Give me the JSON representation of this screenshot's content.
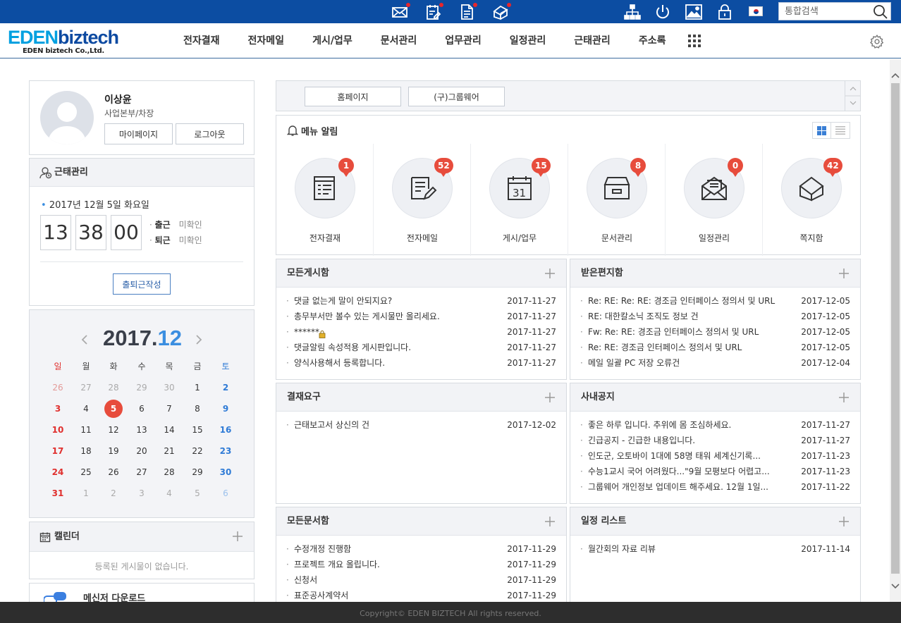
{
  "topbar": {
    "search_placeholder": "통합검색",
    "icons": [
      "mail-icon",
      "approval-icon",
      "document-icon",
      "memo-icon",
      "org-chart-icon",
      "power-icon",
      "image-icon",
      "lock-icon",
      "flag-korea-icon",
      "search-icon"
    ]
  },
  "header": {
    "logo_main_a": "EDEN",
    "logo_main_b": "biztech",
    "logo_sub": "EDEN biztech Co.,Ltd.",
    "nav": [
      "전자결재",
      "전자메일",
      "게시/업무",
      "문서관리",
      "업무관리",
      "일정관리",
      "근태관리",
      "주소록"
    ]
  },
  "profile": {
    "name": "이상윤",
    "dept": "사업본부/차장",
    "mypage_label": "마이페이지",
    "logout_label": "로그아웃"
  },
  "attendance": {
    "title": "근태관리",
    "date": "2017년 12월 5일 화요일",
    "hour": "13",
    "minute": "38",
    "second": "00",
    "in_label": "출근",
    "in_status": "미확인",
    "out_label": "퇴근",
    "out_status": "미확인",
    "write_label": "출퇴근작성"
  },
  "calendar": {
    "year": "2017.",
    "month": "12",
    "weekdays": [
      "일",
      "월",
      "화",
      "수",
      "목",
      "금",
      "토"
    ],
    "days": [
      [
        "26",
        "27",
        "28",
        "29",
        "30",
        "1",
        "2"
      ],
      [
        "3",
        "4",
        "5",
        "6",
        "7",
        "8",
        "9"
      ],
      [
        "10",
        "11",
        "12",
        "13",
        "14",
        "15",
        "16"
      ],
      [
        "17",
        "18",
        "19",
        "20",
        "21",
        "22",
        "23"
      ],
      [
        "24",
        "25",
        "26",
        "27",
        "28",
        "29",
        "30"
      ],
      [
        "31",
        "1",
        "2",
        "3",
        "4",
        "5",
        "6"
      ]
    ],
    "today": "5"
  },
  "schedule_widget": {
    "title": "캘린더",
    "empty": "등록된 게시물이 없습니다."
  },
  "messenger": {
    "title": "메신저 다운로드"
  },
  "quicklinks": [
    "홈페이지",
    "(구)그룹웨어"
  ],
  "menu_alert": {
    "title": "메뉴 알림",
    "items": [
      {
        "label": "전자결재",
        "count": "1",
        "icon": "approval-doc-icon"
      },
      {
        "label": "전자메일",
        "count": "52",
        "icon": "mail-edit-icon"
      },
      {
        "label": "게시/업무",
        "count": "15",
        "icon": "calendar-31-icon"
      },
      {
        "label": "문서관리",
        "count": "8",
        "icon": "archive-box-icon"
      },
      {
        "label": "일정관리",
        "count": "0",
        "icon": "envelope-open-icon"
      },
      {
        "label": "쪽지함",
        "count": "42",
        "icon": "paper-plane-icon"
      }
    ]
  },
  "boards": {
    "all_posts": {
      "title": "모든게시함",
      "items": [
        {
          "t": "댓글 없는게 말이 안되지요?",
          "d": "2017-11-27"
        },
        {
          "t": "총무부서만 볼수 있는 게시물만 올리세요.",
          "d": "2017-11-27"
        },
        {
          "t": "******",
          "d": "2017-11-27",
          "locked": true
        },
        {
          "t": "댓글알림 속성적용 게시판입니다.",
          "d": "2017-11-27"
        },
        {
          "t": "양식사용해서 등록합니다.",
          "d": "2017-11-27"
        }
      ]
    },
    "inbox": {
      "title": "받은편지함",
      "items": [
        {
          "t": "Re: RE: Re: RE: 경조금 인터페이스 정의서 및 URL",
          "d": "2017-12-05"
        },
        {
          "t": "RE: 대한칼소닉 조직도 정보 건",
          "d": "2017-12-05"
        },
        {
          "t": "Fw: Re: RE: 경조금 인터페이스 정의서 및 URL",
          "d": "2017-12-05"
        },
        {
          "t": "Re: RE: 경조금 인터페이스 정의서 및 URL",
          "d": "2017-12-05"
        },
        {
          "t": "메일 일괄 PC 저장 오류건",
          "d": "2017-12-04"
        }
      ]
    },
    "approval": {
      "title": "결재요구",
      "items": [
        {
          "t": "근태보고서 상신의 건",
          "d": "2017-12-02"
        }
      ]
    },
    "notice": {
      "title": "사내공지",
      "items": [
        {
          "t": "좋은 하루 입니다. 추위에 몸 조심하세요.",
          "d": "2017-11-27"
        },
        {
          "t": "긴급공지 - 긴급한 내용입니다.",
          "d": "2017-11-27"
        },
        {
          "t": "인도군, 오토바이 1대에 58명 태워 세계신기록...",
          "d": "2017-11-23"
        },
        {
          "t": "수능1교시 국어 어려웠다...\"9월 모평보다 어렵고...",
          "d": "2017-11-23"
        },
        {
          "t": "그룹웨어 개인정보 업데이트 해주세요. 12월 1일...",
          "d": "2017-11-22"
        }
      ]
    },
    "docs": {
      "title": "모든문서함",
      "items": [
        {
          "t": "수정개정 진행함",
          "d": "2017-11-29"
        },
        {
          "t": "프로젝트 개요 올립니다.",
          "d": "2017-11-29"
        },
        {
          "t": "신청서",
          "d": "2017-11-29"
        },
        {
          "t": "표준공사계약서",
          "d": "2017-11-29"
        }
      ]
    },
    "schedule_list": {
      "title": "일정 리스트",
      "items": [
        {
          "t": "월간회의 자료 리뷰",
          "d": "2017-11-14"
        }
      ]
    }
  },
  "footer": {
    "copyright": "Copyright© EDEN BIZTECH All rights reserved."
  },
  "colors": {
    "topbar": "#0c4da2",
    "badge": "#e74c3c",
    "sunday": "#e0302e",
    "saturday": "#2f7bd6",
    "today_circle": "#e74c3c",
    "month_accent": "#3b8ee0"
  }
}
